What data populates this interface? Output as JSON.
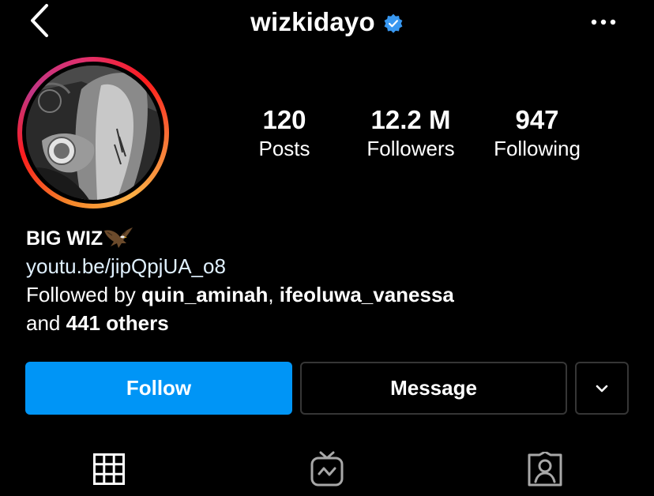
{
  "header": {
    "username": "wizkidayo",
    "back_icon": "chevron-left-icon",
    "verified_icon": "verified-badge-icon",
    "more_icon": "more-horizontal-icon"
  },
  "profile": {
    "avatar_icon": "profile-photo",
    "stats": {
      "posts": {
        "value": "120",
        "label": "Posts"
      },
      "followers": {
        "value": "12.2 M",
        "label": "Followers"
      },
      "following": {
        "value": "947",
        "label": "Following"
      }
    },
    "bio": {
      "name": "BIG WIZ",
      "emoji_icon": "eagle-icon",
      "link": "youtu.be/jipQpjUA_o8",
      "followed_by_prefix": "Followed by ",
      "followed_user_1": "quin_aminah",
      "followed_separator": ", ",
      "followed_user_2": "ifeoluwa_vanessa",
      "and_text": "and ",
      "others_text": "441 others"
    }
  },
  "actions": {
    "follow_label": "Follow",
    "message_label": "Message",
    "dropdown_icon": "chevron-down-icon"
  },
  "tabs": [
    {
      "icon": "grid-icon"
    },
    {
      "icon": "igtv-icon"
    },
    {
      "icon": "tagged-icon"
    }
  ],
  "colors": {
    "background": "#000000",
    "accent": "#0095f6",
    "verified": "#3897f0",
    "link": "#e0f1ff",
    "border": "#363636"
  }
}
